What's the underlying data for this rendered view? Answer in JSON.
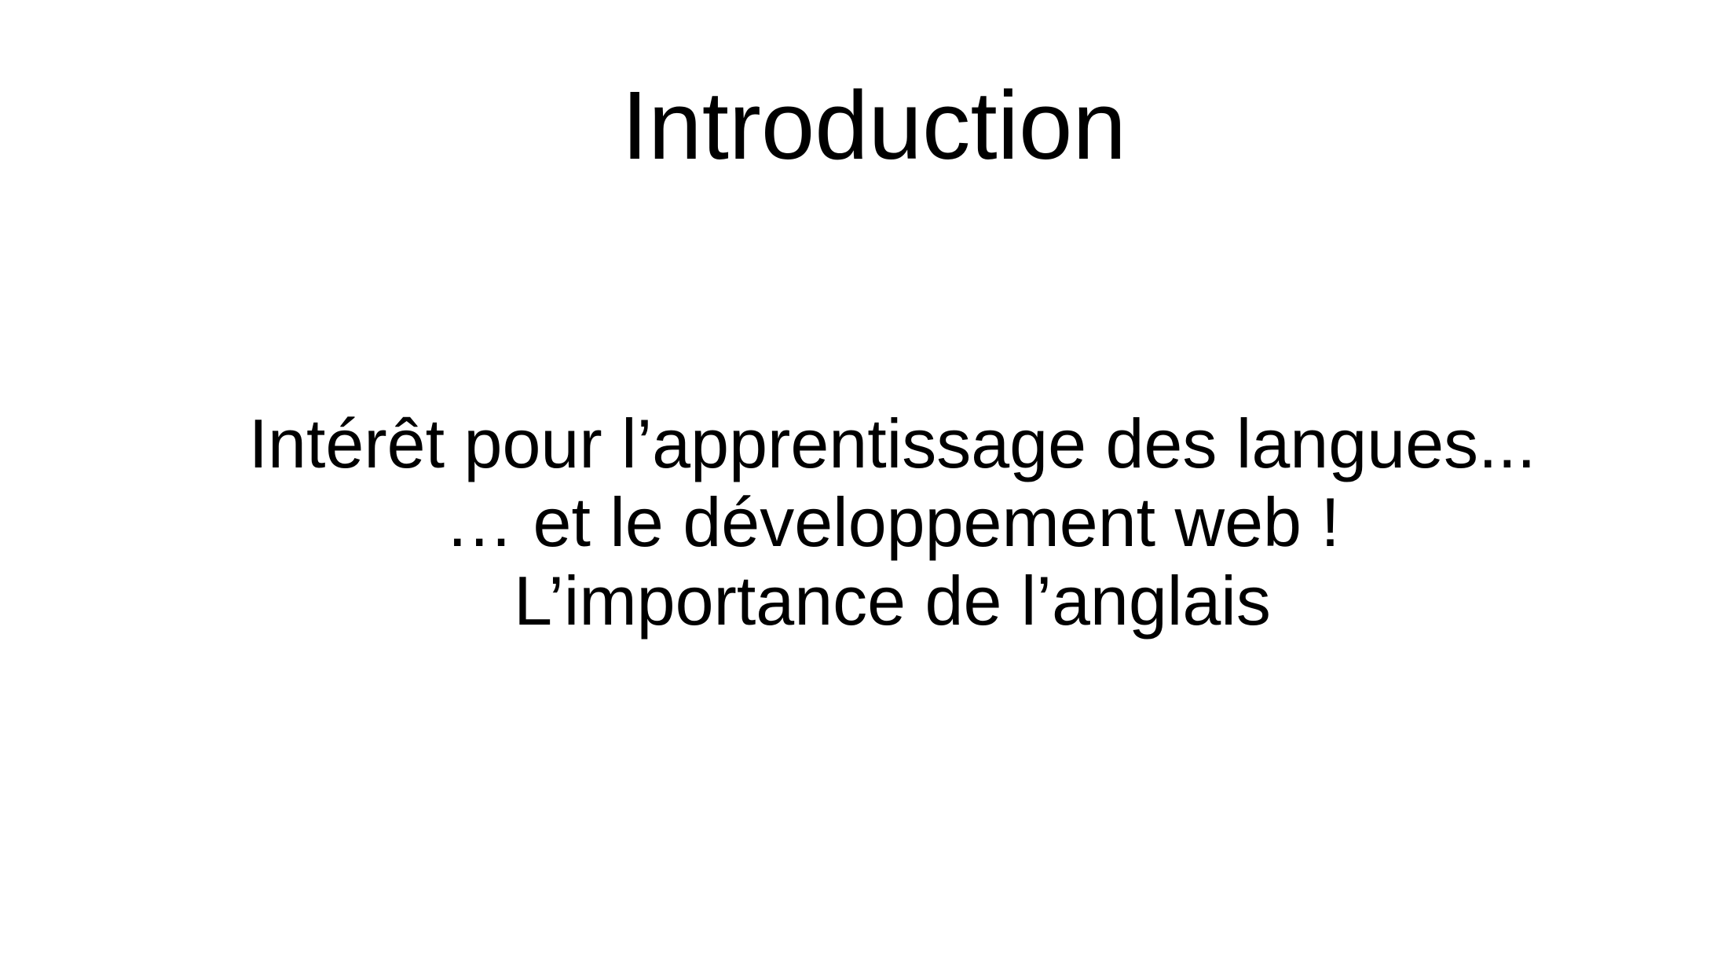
{
  "slide": {
    "title": "Introduction",
    "lines": [
      "Intérêt pour l’apprentissage des langues...",
      "… et le développement web !",
      "L’importance de l’anglais"
    ]
  }
}
